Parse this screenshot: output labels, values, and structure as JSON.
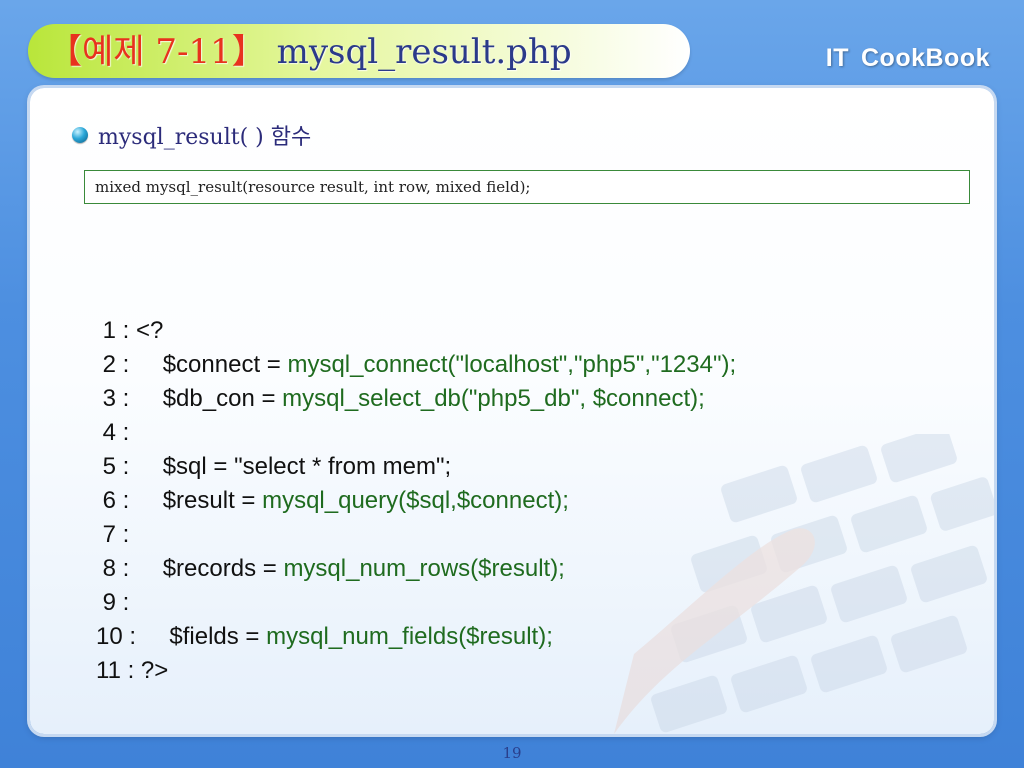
{
  "header": {
    "title_bracket": "【예제 7-11】",
    "title_main": "mysql_result.php",
    "brand_part1": "IT",
    "brand_part2": "CookBook"
  },
  "content": {
    "bullet_label": "mysql_result( ) 함수",
    "syntax": "mixed mysql_result(resource result, int row, mixed field);",
    "code_lines": [
      {
        "num": " 1 : ",
        "plain": "<?",
        "fn": ""
      },
      {
        "num": " 2 : ",
        "plain": "    $connect = ",
        "fn": "mysql_connect(\"localhost\",\"php5\",\"1234\");"
      },
      {
        "num": " 3 : ",
        "plain": "    $db_con = ",
        "fn": "mysql_select_db(\"php5_db\", $connect);"
      },
      {
        "num": " 4 : ",
        "plain": "",
        "fn": ""
      },
      {
        "num": " 5 : ",
        "plain": "    $sql = \"select * from mem\";",
        "fn": ""
      },
      {
        "num": " 6 : ",
        "plain": "    $result = ",
        "fn": "mysql_query($sql,$connect);"
      },
      {
        "num": " 7 : ",
        "plain": "",
        "fn": ""
      },
      {
        "num": " 8 : ",
        "plain": "    $records = ",
        "fn": "mysql_num_rows($result);"
      },
      {
        "num": " 9 : ",
        "plain": "",
        "fn": ""
      },
      {
        "num": "10 : ",
        "plain": "    $fields = ",
        "fn": "mysql_num_fields($result);"
      },
      {
        "num": "11 : ",
        "plain": "?>",
        "fn": ""
      }
    ]
  },
  "footer": {
    "page_number": "19"
  },
  "colors": {
    "title_bracket": "#e8321e",
    "title_text": "#2b3a8a",
    "function_green": "#1f6b1f",
    "background_blue": "#4d8fe0"
  }
}
